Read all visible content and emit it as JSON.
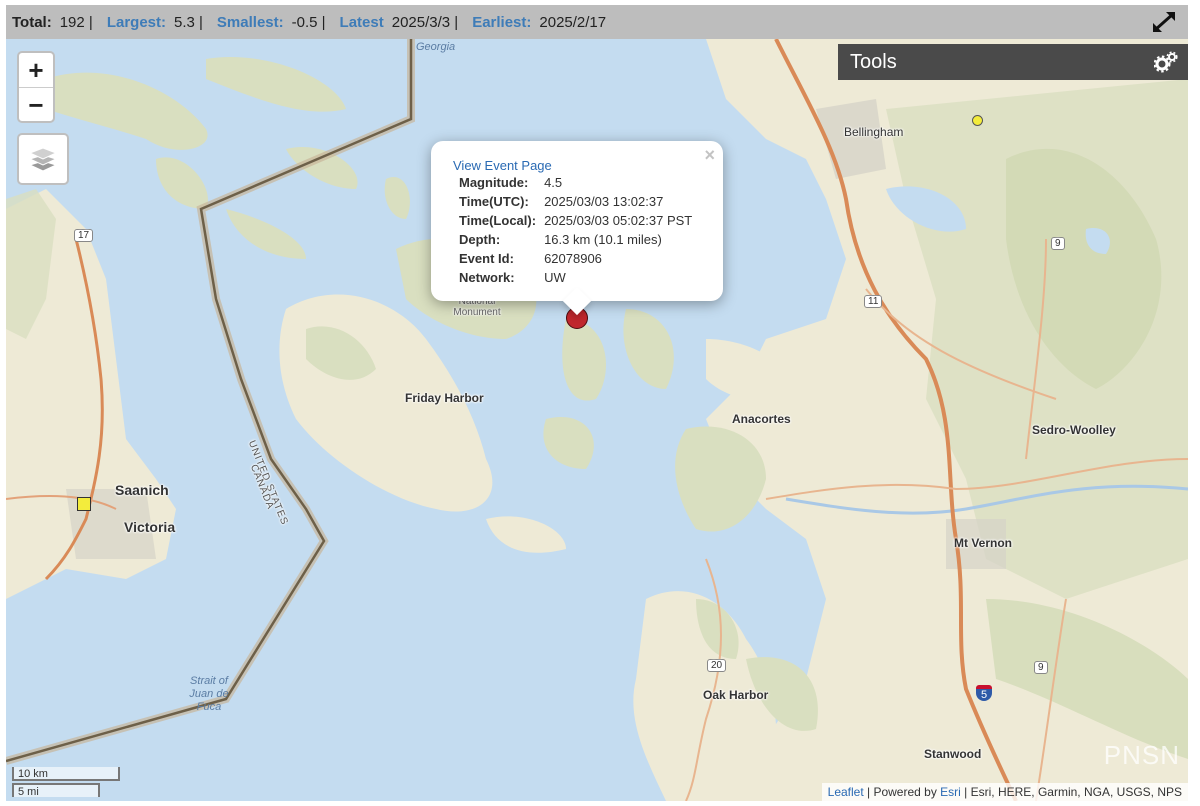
{
  "stats": {
    "total_label": "Total:",
    "total": "192 |",
    "largest_label": "Largest:",
    "largest": "5.3 |",
    "smallest_label": "Smallest:",
    "smallest": "-0.5 |",
    "latest_label": "Latest",
    "latest": "2025/3/3 |",
    "earliest_label": "Earliest:",
    "earliest": "2025/2/17"
  },
  "tools": {
    "title": "Tools"
  },
  "zoom": {
    "in": "+",
    "out": "−"
  },
  "popup": {
    "link": "View Event Page",
    "close": "×",
    "rows": [
      {
        "k": "Magnitude:",
        "v": "4.5"
      },
      {
        "k": "Time(UTC):",
        "v": "2025/03/03 13:02:37"
      },
      {
        "k": "Time(Local):",
        "v": "2025/03/03 05:02:37 PST"
      },
      {
        "k": "Depth:",
        "v": "16.3 km (10.1 miles)"
      },
      {
        "k": "Event Id:",
        "v": "62078906"
      },
      {
        "k": "Network:",
        "v": "UW"
      }
    ]
  },
  "places": {
    "bellingham": "Bellingham",
    "saanich": "Saanich",
    "victoria": "Victoria",
    "friday_harbor": "Friday Harbor",
    "anacortes": "Anacortes",
    "sedro_woolley": "Sedro-Woolley",
    "mt_vernon": "Mt Vernon",
    "oak_harbor": "Oak Harbor",
    "stanwood": "Stanwood",
    "national_monument": "National Monument",
    "georgia": "Georgia",
    "united_states": "UNITED STATES",
    "canada": "CANADA",
    "strait": "Strait of Juan de Fuca",
    "hwy_17": "17",
    "hwy_9a": "9",
    "hwy_9b": "9",
    "hwy_11": "11",
    "hwy_20": "20",
    "hwy_5": "5"
  },
  "scale": {
    "km": "10 km",
    "mi": "5 mi"
  },
  "watermark": "PNSN",
  "attribution": {
    "leaflet": "Leaflet",
    "powered": " | Powered by ",
    "esri": "Esri",
    "rest": " | Esri, HERE, Garmin, NGA, USGS, NPS"
  },
  "colors": {
    "water": "#c4dcf0",
    "land": "#eeead6",
    "quake_main": "#c0272d",
    "quake_small": "#f3ec3c"
  }
}
